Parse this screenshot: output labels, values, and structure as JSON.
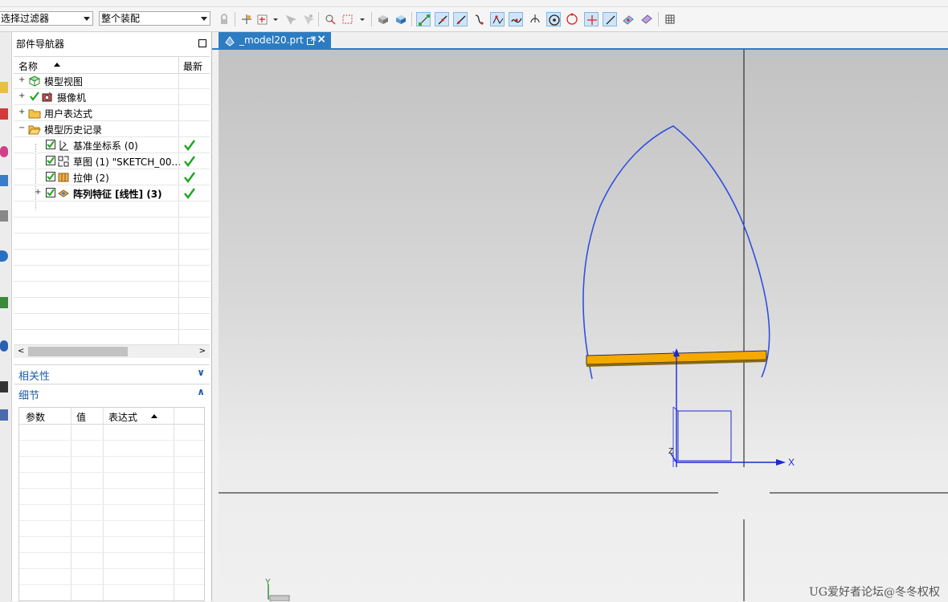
{
  "toolbar": {
    "filter_combo": "选择过滤器",
    "scope_combo": "整个装配"
  },
  "navigator": {
    "title": "部件导航器",
    "col_name": "名称",
    "col_latest": "最新",
    "rows": [
      {
        "label": "模型视图",
        "checked": false,
        "icon": "model-views-icon",
        "expander": "+",
        "latest": false
      },
      {
        "label": "摄像机",
        "checked": true,
        "icon": "camera-icon",
        "expander": "+",
        "latest": false
      },
      {
        "label": "用户表达式",
        "checked": false,
        "icon": "folder-icon",
        "expander": "+",
        "latest": false
      },
      {
        "label": "模型历史记录",
        "checked": false,
        "icon": "folder-open-icon",
        "expander": "−",
        "latest": false
      },
      {
        "label": "基准坐标系 (0)",
        "checked": true,
        "icon": "datum-csys-icon",
        "expander": "",
        "latest": true
      },
      {
        "label": "草图 (1) \"SKETCH_00...",
        "checked": true,
        "icon": "sketch-icon",
        "expander": "",
        "latest": true
      },
      {
        "label": "拉伸 (2)",
        "checked": true,
        "icon": "extrude-icon",
        "expander": "",
        "latest": true
      },
      {
        "label": "阵列特征 [线性] (3)",
        "checked": true,
        "icon": "pattern-feature-icon",
        "expander": "+",
        "latest": true,
        "bold": true
      }
    ]
  },
  "dependencies": {
    "title": "相关性"
  },
  "details": {
    "title": "细节",
    "col_param": "参数",
    "col_value": "值",
    "col_expr": "表达式"
  },
  "viewport": {
    "tab_name": "_model20.prt",
    "axis_x": "X",
    "axis_y": "Y",
    "axis_z": "Z",
    "triad_y": "Y",
    "colors": {
      "curve": "#3050e0",
      "solid": "#f5a800",
      "axis": "#1a2ad0"
    }
  },
  "watermark": "UG爱好者论坛@冬冬权权"
}
